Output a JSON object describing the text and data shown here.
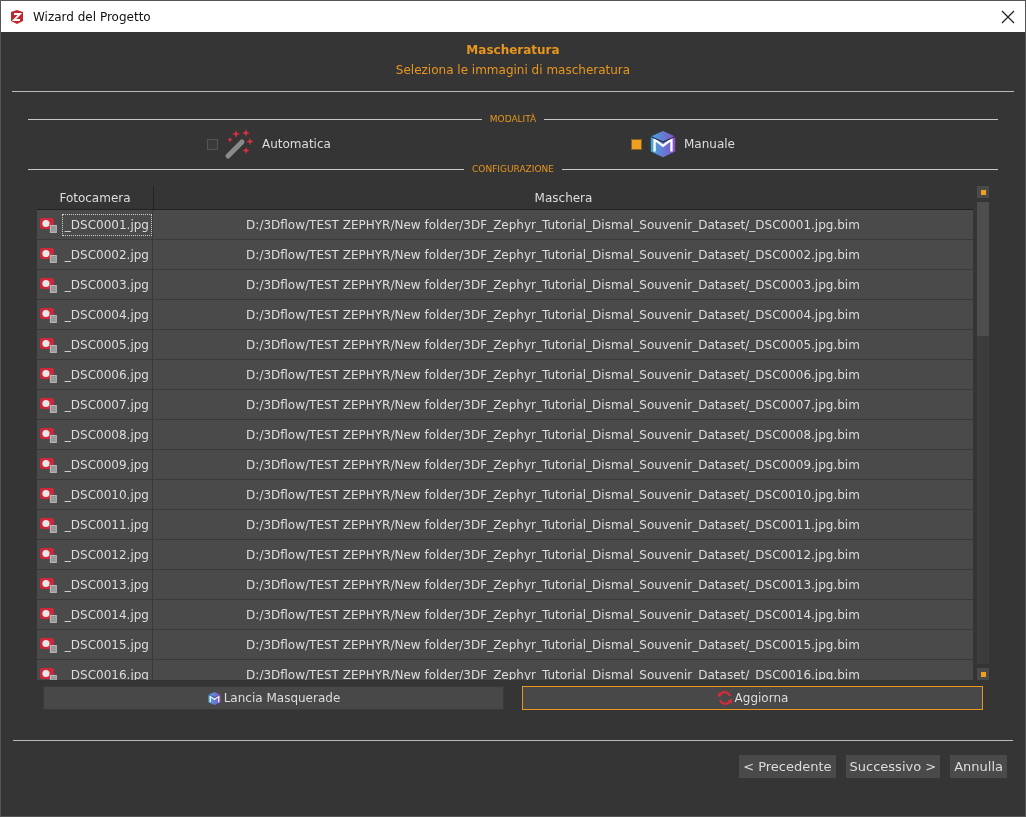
{
  "window": {
    "title": "Wizard del Progetto"
  },
  "header": {
    "title": "Mascheratura",
    "subtitle": "Seleziona le immagini di mascheratura"
  },
  "mode_section": {
    "label": "MODALITÀ"
  },
  "modes": [
    {
      "kind": "auto",
      "label": "Automatica",
      "selected": false
    },
    {
      "kind": "manual",
      "label": "Manuale",
      "selected": true
    }
  ],
  "config_section": {
    "label": "CONFIGURAZIONE"
  },
  "table": {
    "columns": [
      "Fotocamera",
      "Maschera"
    ],
    "rows": [
      {
        "camera": "_DSC0001.jpg",
        "mask": "D:/3Dflow/TEST ZEPHYR/New folder/3DF_Zephyr_Tutorial_Dismal_Souvenir_Dataset/_DSC0001.jpg.bim",
        "focused": true
      },
      {
        "camera": "_DSC0002.jpg",
        "mask": "D:/3Dflow/TEST ZEPHYR/New folder/3DF_Zephyr_Tutorial_Dismal_Souvenir_Dataset/_DSC0002.jpg.bim",
        "focused": false
      },
      {
        "camera": "_DSC0003.jpg",
        "mask": "D:/3Dflow/TEST ZEPHYR/New folder/3DF_Zephyr_Tutorial_Dismal_Souvenir_Dataset/_DSC0003.jpg.bim",
        "focused": false
      },
      {
        "camera": "_DSC0004.jpg",
        "mask": "D:/3Dflow/TEST ZEPHYR/New folder/3DF_Zephyr_Tutorial_Dismal_Souvenir_Dataset/_DSC0004.jpg.bim",
        "focused": false
      },
      {
        "camera": "_DSC0005.jpg",
        "mask": "D:/3Dflow/TEST ZEPHYR/New folder/3DF_Zephyr_Tutorial_Dismal_Souvenir_Dataset/_DSC0005.jpg.bim",
        "focused": false
      },
      {
        "camera": "_DSC0006.jpg",
        "mask": "D:/3Dflow/TEST ZEPHYR/New folder/3DF_Zephyr_Tutorial_Dismal_Souvenir_Dataset/_DSC0006.jpg.bim",
        "focused": false
      },
      {
        "camera": "_DSC0007.jpg",
        "mask": "D:/3Dflow/TEST ZEPHYR/New folder/3DF_Zephyr_Tutorial_Dismal_Souvenir_Dataset/_DSC0007.jpg.bim",
        "focused": false
      },
      {
        "camera": "_DSC0008.jpg",
        "mask": "D:/3Dflow/TEST ZEPHYR/New folder/3DF_Zephyr_Tutorial_Dismal_Souvenir_Dataset/_DSC0008.jpg.bim",
        "focused": false
      },
      {
        "camera": "_DSC0009.jpg",
        "mask": "D:/3Dflow/TEST ZEPHYR/New folder/3DF_Zephyr_Tutorial_Dismal_Souvenir_Dataset/_DSC0009.jpg.bim",
        "focused": false
      },
      {
        "camera": "_DSC0010.jpg",
        "mask": "D:/3Dflow/TEST ZEPHYR/New folder/3DF_Zephyr_Tutorial_Dismal_Souvenir_Dataset/_DSC0010.jpg.bim",
        "focused": false
      },
      {
        "camera": "_DSC0011.jpg",
        "mask": "D:/3Dflow/TEST ZEPHYR/New folder/3DF_Zephyr_Tutorial_Dismal_Souvenir_Dataset/_DSC0011.jpg.bim",
        "focused": false
      },
      {
        "camera": "_DSC0012.jpg",
        "mask": "D:/3Dflow/TEST ZEPHYR/New folder/3DF_Zephyr_Tutorial_Dismal_Souvenir_Dataset/_DSC0012.jpg.bim",
        "focused": false
      },
      {
        "camera": "_DSC0013.jpg",
        "mask": "D:/3Dflow/TEST ZEPHYR/New folder/3DF_Zephyr_Tutorial_Dismal_Souvenir_Dataset/_DSC0013.jpg.bim",
        "focused": false
      },
      {
        "camera": "_DSC0014.jpg",
        "mask": "D:/3Dflow/TEST ZEPHYR/New folder/3DF_Zephyr_Tutorial_Dismal_Souvenir_Dataset/_DSC0014.jpg.bim",
        "focused": false
      },
      {
        "camera": "_DSC0015.jpg",
        "mask": "D:/3Dflow/TEST ZEPHYR/New folder/3DF_Zephyr_Tutorial_Dismal_Souvenir_Dataset/_DSC0015.jpg.bim",
        "focused": false
      },
      {
        "camera": "_DSC0016.jpg",
        "mask": "D:/3Dflow/TEST ZEPHYR/New folder/3DF_Zephyr_Tutorial_Dismal_Souvenir_Dataset/_DSC0016.jpg.bim",
        "focused": false
      }
    ]
  },
  "actions": [
    {
      "kind": "masquerade",
      "label": "Lancia Masquerade",
      "focused": false
    },
    {
      "kind": "refresh",
      "label": "Aggiorna",
      "focused": true
    }
  ],
  "buttons": [
    "< Precedente",
    "Successivo >",
    "Annulla"
  ]
}
